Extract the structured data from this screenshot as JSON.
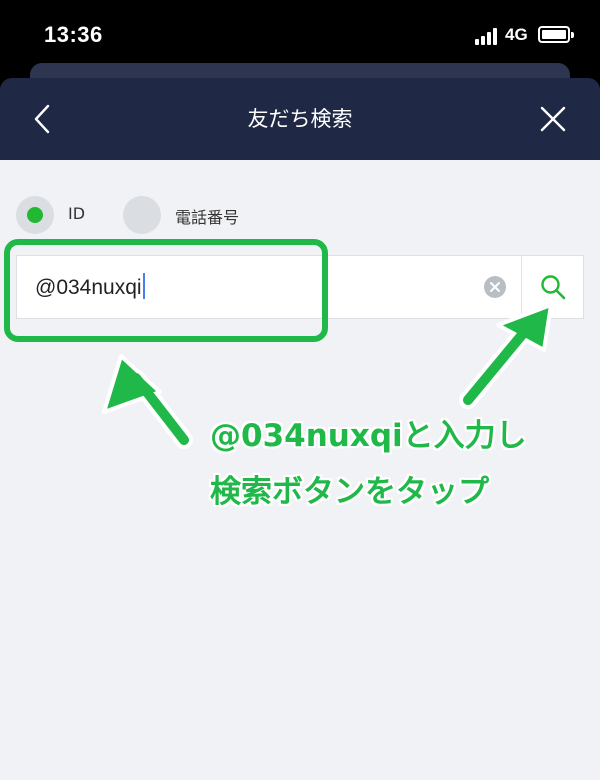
{
  "status_bar": {
    "time": "13:36",
    "network": "4G",
    "signal_icon": "cellular-signal-icon",
    "battery_icon": "battery-icon"
  },
  "header": {
    "title": "友だち検索",
    "back_icon": "chevron-left-icon",
    "close_icon": "close-icon",
    "background": "#1f2845"
  },
  "search_type": {
    "options": [
      {
        "label": "ID",
        "selected": true
      },
      {
        "label": "電話番号",
        "selected": false
      }
    ],
    "accent": "#21b834"
  },
  "search": {
    "value": "@034nuxqi",
    "clear_icon": "clear-circle-icon",
    "search_icon": "search-icon"
  },
  "annotation": {
    "line1": "@034nuxqiと入力し",
    "line2": "検索ボタンをタップ",
    "color": "#21b84a"
  }
}
